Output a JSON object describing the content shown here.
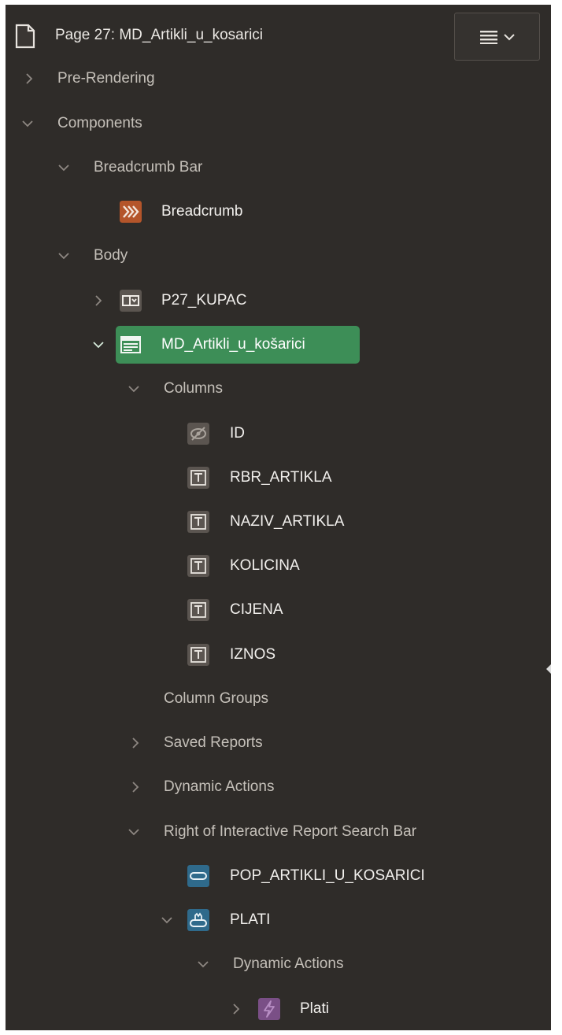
{
  "header": {
    "page_title": "Page 27: MD_Artikli_u_kosarici",
    "page_icon": "page-icon",
    "menu_icon": "menu-lines-icon"
  },
  "tree": {
    "pre_rendering": "Pre-Rendering",
    "components": "Components",
    "breadcrumb_bar": "Breadcrumb Bar",
    "breadcrumb": "Breadcrumb",
    "body": "Body",
    "p27_kupac": "P27_KUPAC",
    "report": "MD_Artikli_u_košarici",
    "columns": "Columns",
    "col_id": "ID",
    "col_rbr": "RBR_ARTIKLA",
    "col_naziv": "NAZIV_ARTIKLA",
    "col_kolicina": "KOLICINA",
    "col_cijena": "CIJENA",
    "col_iznos": "IZNOS",
    "column_groups": "Column Groups",
    "saved_reports": "Saved Reports",
    "dynamic_actions": "Dynamic Actions",
    "right_of_search": "Right of Interactive Report Search Bar",
    "pop_artikli": "POP_ARTIKLI_U_KOSARICI",
    "plati_button": "PLATI",
    "plati_dynamic_actions": "Dynamic Actions",
    "plati_action": "Plati"
  },
  "colors": {
    "panel_bg": "#2f2c29",
    "selected": "#3d8e57",
    "breadcrumb_icon": "#b4552a",
    "item_icon": "#5b5550",
    "button_icon": "#2f6a8b",
    "action_icon": "#7a4f86"
  }
}
